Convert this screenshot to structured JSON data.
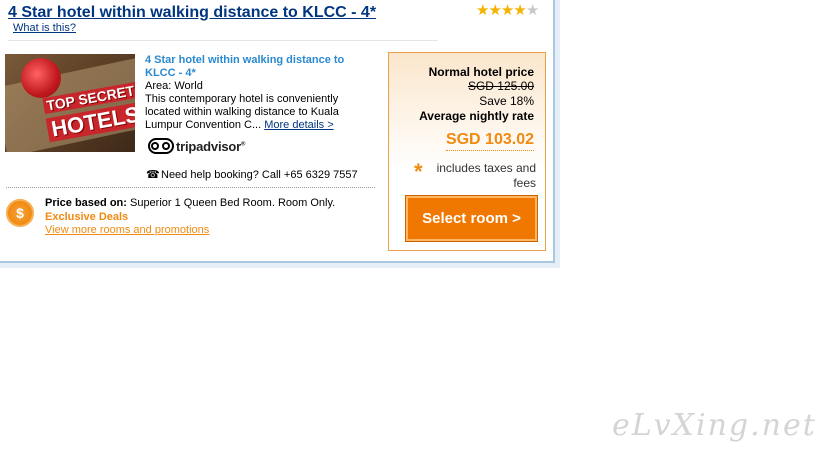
{
  "header": {
    "title": "4 Star hotel within walking distance to KLCC - 4*",
    "what_is_this": "What is this?",
    "rating_stars": 4,
    "rating_max": 5
  },
  "hotel": {
    "image_text_line1": "TOP SECRET",
    "image_text_line2": "HOTELS",
    "name": "4 Star hotel within walking distance to KLCC - 4*",
    "area": "Area: World",
    "description": "This contemporary hotel is conveniently located within walking distance to Kuala Lumpur Convention C...",
    "more_details": "More details >",
    "tripadvisor_label": "tripadvisor",
    "help_text": "Need help booking? Call +65 6329 7557"
  },
  "pricing": {
    "coin_symbol": "$",
    "price_based_label": "Price based on:",
    "price_based_value": "Superior 1 Queen Bed Room. Room Only.",
    "exclusive_deals": "Exclusive Deals",
    "view_more": "View more rooms and promotions"
  },
  "price_box": {
    "normal_label": "Normal hotel price",
    "normal_price": "SGD 125.00",
    "save_text": "Save 18%",
    "avg_label": "Average nightly rate",
    "avg_price": "SGD 103.02",
    "tax_note": "includes taxes and fees",
    "select_button": "Select room  >"
  },
  "watermark": "eLvXing.net",
  "colors": {
    "link_blue": "#003580",
    "hotel_name_blue": "#2a8ad0",
    "accent_orange": "#f08a10",
    "button_orange": "#f07800",
    "star_gold": "#f6b200",
    "star_grey": "#c8c8c8"
  }
}
